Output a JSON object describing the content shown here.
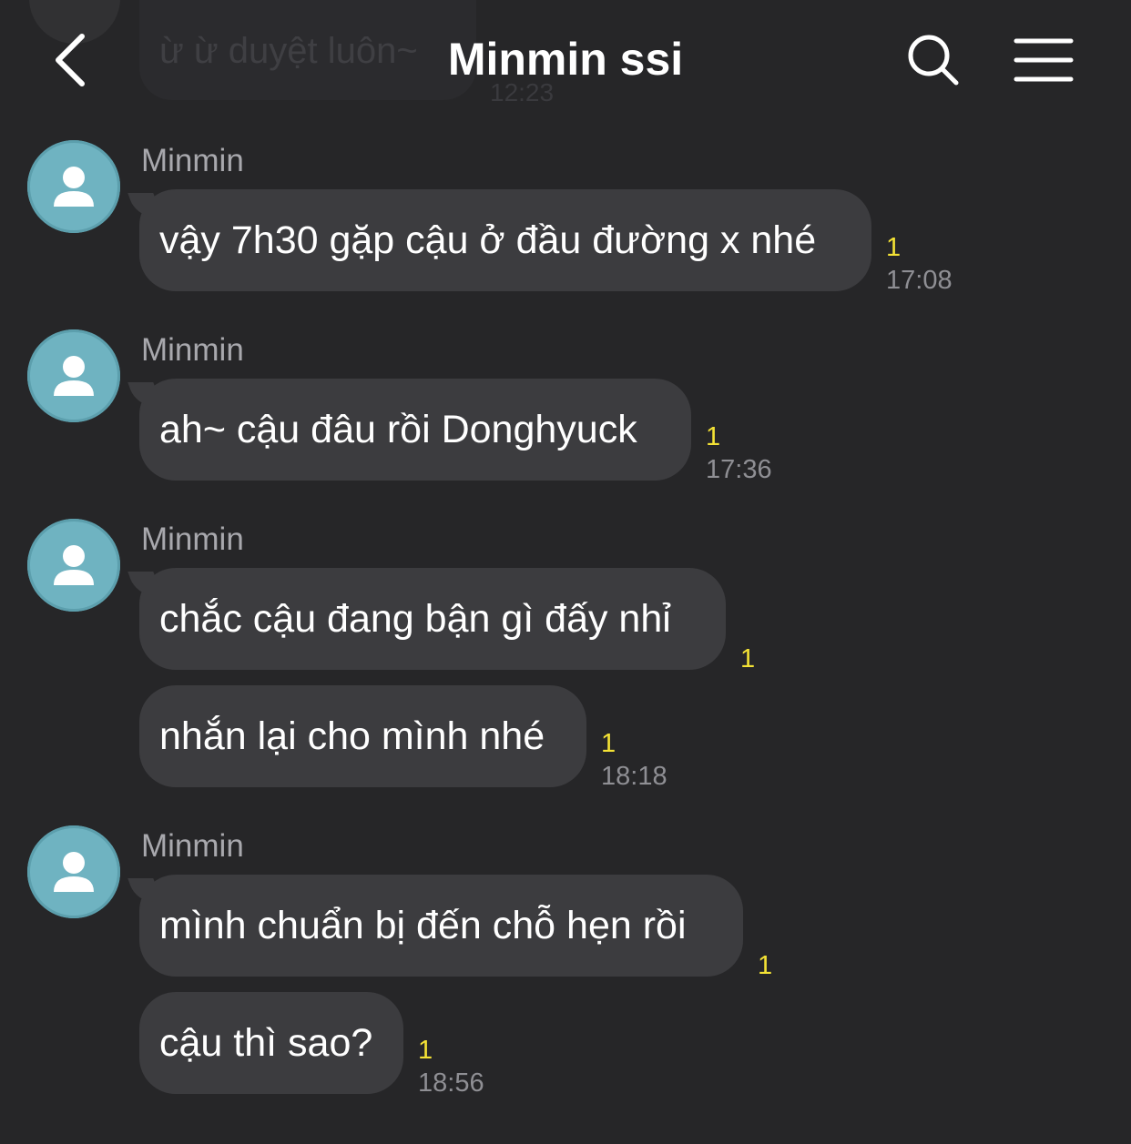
{
  "header": {
    "title": "Minmin ssi",
    "back_icon": "chevron-left-icon",
    "search_icon": "search-icon",
    "menu_icon": "hamburger-menu-icon"
  },
  "previous_message": {
    "text": "ừ ừ duyệt luôn~",
    "time": "12:23"
  },
  "messages": [
    {
      "sender": "Minmin",
      "avatar_icon": "default-user-icon",
      "text": "vậy 7h30 gặp cậu ở đầu đường x nhé",
      "unread": "1",
      "time": "17:08"
    },
    {
      "sender": "Minmin",
      "avatar_icon": "default-user-icon",
      "text": "ah~ cậu đâu rồi Donghyuck",
      "unread": "1",
      "time": "17:36"
    },
    {
      "sender": "Minmin",
      "avatar_icon": "default-user-icon",
      "text": "chắc cậu đang bận gì đấy nhỉ",
      "unread": "1",
      "time": ""
    },
    {
      "sender": "",
      "text": "nhắn lại cho mình nhé",
      "unread": "1",
      "time": "18:18"
    },
    {
      "sender": "Minmin",
      "avatar_icon": "default-user-icon",
      "text": "mình chuẩn bị đến chỗ hẹn rồi",
      "unread": "1",
      "time": ""
    },
    {
      "sender": "",
      "text": "cậu thì sao?",
      "unread": "1",
      "time": "18:56"
    }
  ],
  "colors": {
    "background": "#262628",
    "bubble": "#3c3c3f",
    "avatar": "#6fb3c1",
    "unread": "#f4e235",
    "timestamp": "#8f8f94",
    "sender": "#a8a8ad"
  }
}
